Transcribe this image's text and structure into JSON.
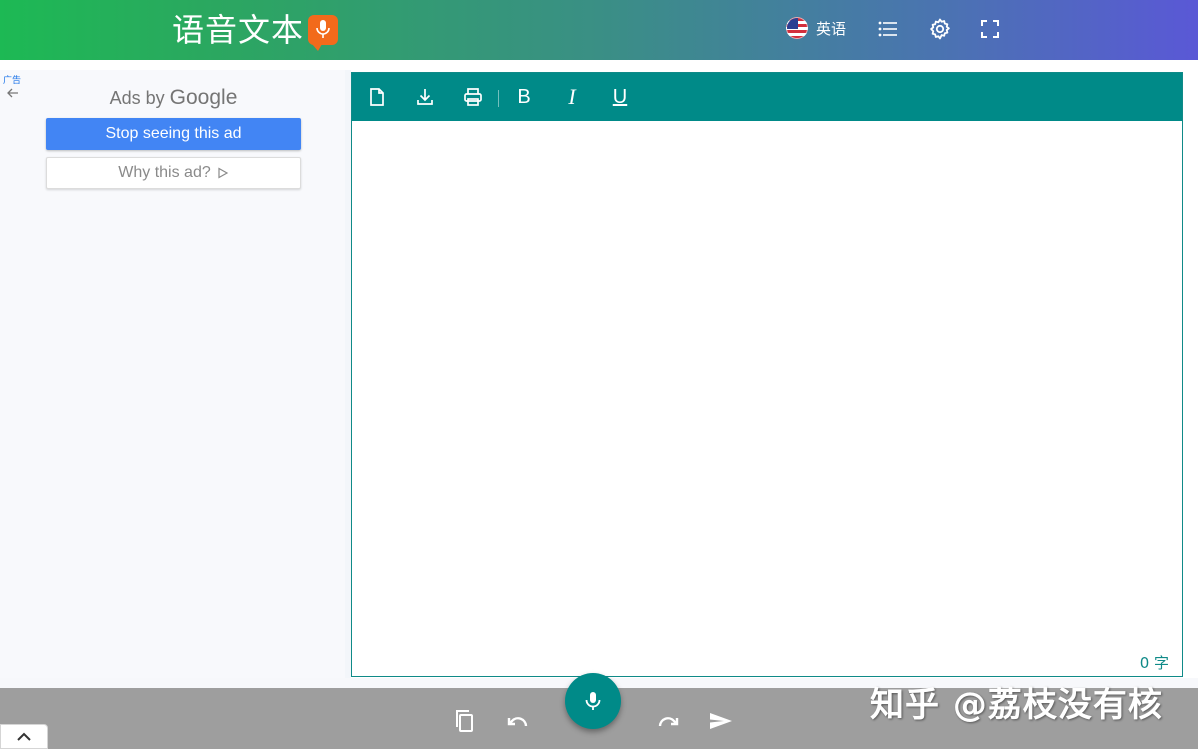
{
  "header": {
    "logo_text": "语音文本",
    "language_label": "英语"
  },
  "ad": {
    "ad_tag": "广告",
    "ads_by_prefix": "Ads by",
    "ads_by_brand": "Google",
    "stop_button": "Stop seeing this ad",
    "why_button": "Why this ad?"
  },
  "editor": {
    "text": "",
    "word_count": "0 字",
    "toolbar": [
      "new-document",
      "download",
      "print",
      "B",
      "I",
      "U"
    ]
  },
  "bottom": {
    "icons": [
      "copy",
      "undo",
      "microphone",
      "redo",
      "send",
      "chevron-up"
    ]
  },
  "watermark": "知乎 @荔枝没有核",
  "colors": {
    "teal": "#008a88",
    "header_start": "#1db954",
    "header_end": "#5a58d6",
    "ad_button": "#4285f4",
    "bottom_bar": "#9e9e9e"
  }
}
